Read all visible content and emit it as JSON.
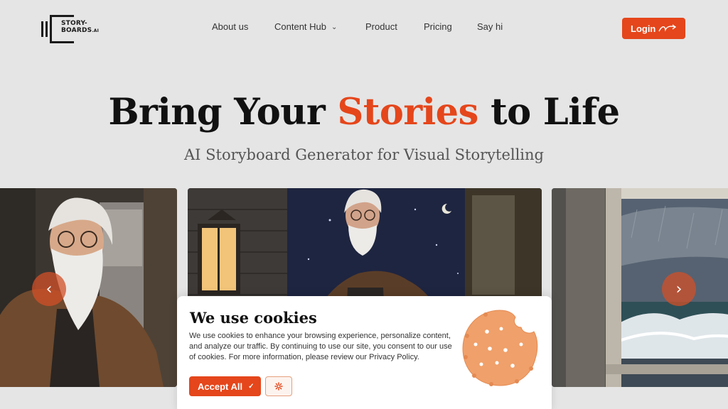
{
  "header": {
    "logo": {
      "line1": "STORY-",
      "line2": "BOARDS",
      "suffix": ".AI"
    },
    "nav": [
      {
        "label": "About us"
      },
      {
        "label": "Content Hub"
      },
      {
        "label": "Product"
      },
      {
        "label": "Pricing"
      },
      {
        "label": "Say hi"
      }
    ],
    "login_label": "Login"
  },
  "hero": {
    "title_part1": "Bring Your ",
    "title_accent": "Stories",
    "title_part2": " to Life",
    "subtitle": "AI Storyboard Generator for Visual Storytelling"
  },
  "carousel": {
    "prev_icon": "chevron-left-icon",
    "next_icon": "chevron-right-icon"
  },
  "cookie": {
    "title": "We use cookies",
    "text": "We use cookies to enhance your browsing experience, personalize content, and analyze our traffic. By continuing to use our site, you consent to our use of cookies. For more information, please review our Privacy Policy.",
    "accept_label": "Accept All",
    "settings_icon": "gear-icon"
  },
  "colors": {
    "accent": "#e5461b",
    "background": "#e5e5e5",
    "text": "#111111"
  }
}
